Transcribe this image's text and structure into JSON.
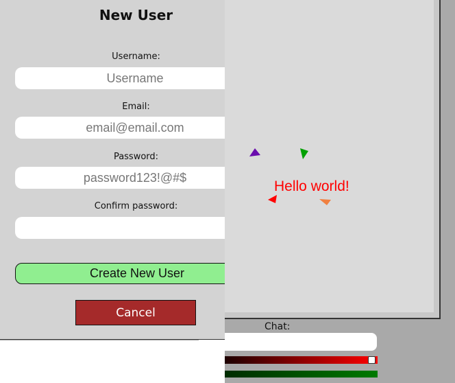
{
  "registration": {
    "title": "New User",
    "username": {
      "label": "Username:",
      "placeholder": "Username",
      "value": ""
    },
    "email": {
      "label": "Email:",
      "placeholder": "email@email.com",
      "value": ""
    },
    "password": {
      "label": "Password:",
      "placeholder": "password123!@#$",
      "value": ""
    },
    "confirm_password": {
      "label": "Confirm password:",
      "placeholder": "",
      "value": ""
    },
    "create_button_label": "Create New User",
    "cancel_button_label": "Cancel"
  },
  "game": {
    "message": "Hello world!",
    "message_color": "#ff0000",
    "players": [
      {
        "color": "#6a0dad"
      },
      {
        "color": "#00a000"
      },
      {
        "color": "#ff0000"
      },
      {
        "color": "#f08040"
      }
    ]
  },
  "chat": {
    "label": "Chat:",
    "input_value": "",
    "red_slider_value": 0.98,
    "green_slider_value": 0.98
  },
  "colors": {
    "panel_bg": "#d3d3d3",
    "create_button": "#90ee90",
    "cancel_button": "#a52a2a",
    "game_bg": "#dadada",
    "page_bg": "#a9a9a9"
  }
}
